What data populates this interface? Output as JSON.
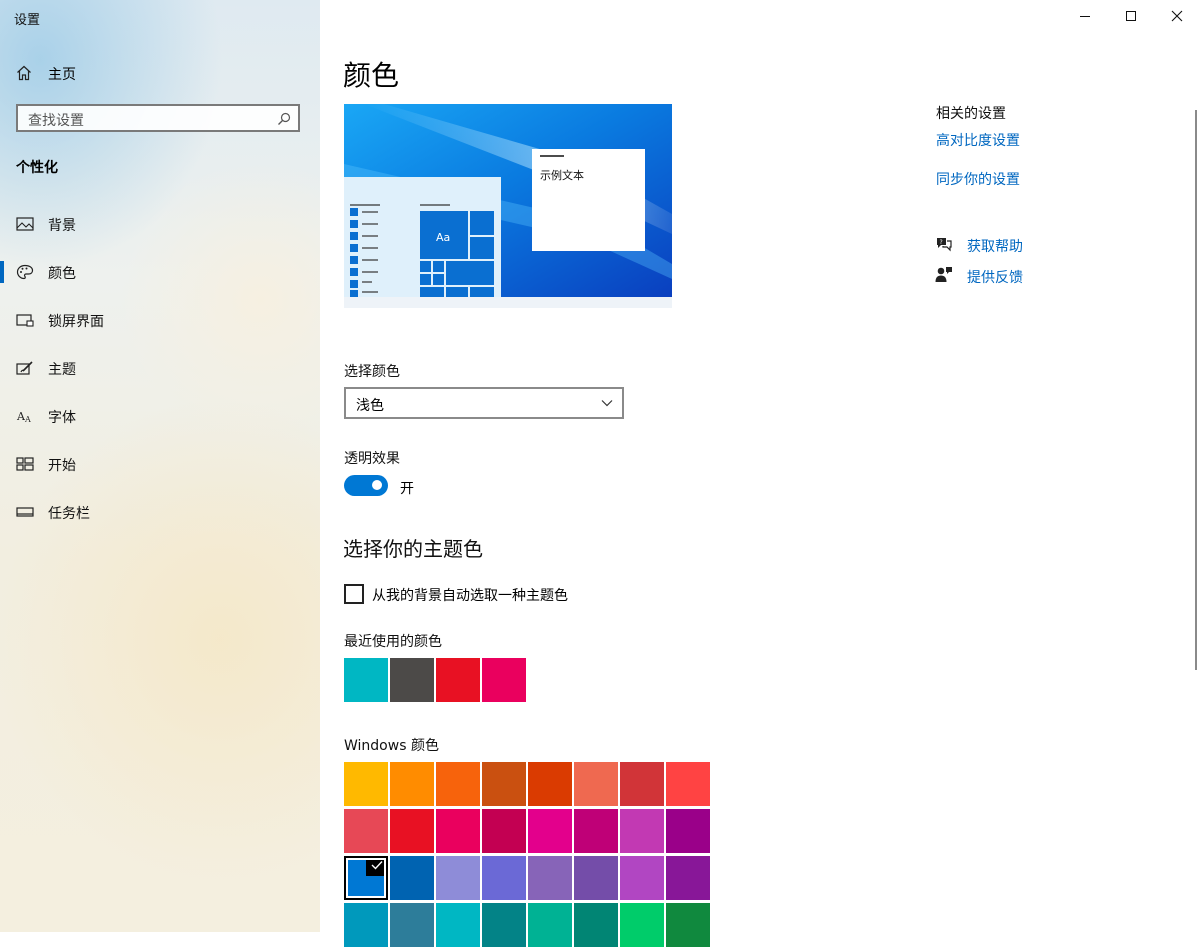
{
  "window": {
    "title": "设置",
    "minimize_icon": "minimize-icon",
    "maximize_icon": "maximize-icon",
    "close_icon": "close-icon"
  },
  "sidebar": {
    "home_label": "主页",
    "search_placeholder": "查找设置",
    "section_title": "个性化",
    "items": [
      {
        "label": "背景",
        "icon": "picture-icon",
        "selected": false
      },
      {
        "label": "颜色",
        "icon": "palette-icon",
        "selected": true
      },
      {
        "label": "锁屏界面",
        "icon": "lock-screen-icon",
        "selected": false
      },
      {
        "label": "主题",
        "icon": "theme-brush-icon",
        "selected": false
      },
      {
        "label": "字体",
        "icon": "font-icon",
        "selected": false
      },
      {
        "label": "开始",
        "icon": "start-menu-icon",
        "selected": false
      },
      {
        "label": "任务栏",
        "icon": "taskbar-icon",
        "selected": false
      }
    ]
  },
  "main": {
    "title": "颜色",
    "preview": {
      "sample_text": "示例文本",
      "tile_text": "Aa"
    },
    "choose_color": {
      "label": "选择颜色",
      "value": "浅色"
    },
    "transparency": {
      "label": "透明效果",
      "state_label": "开",
      "on": true
    },
    "accent_heading": "选择你的主题色",
    "auto_accent": {
      "label": "从我的背景自动选取一种主题色",
      "checked": false
    },
    "recent_colors": {
      "label": "最近使用的颜色",
      "colors": [
        "#00b7c3",
        "#4c4a48",
        "#e81123",
        "#ea005e"
      ]
    },
    "windows_colors": {
      "label": "Windows 颜色",
      "selected": "#0078d4",
      "colors": [
        "#ffb900",
        "#ff8c00",
        "#f7630c",
        "#ca5010",
        "#da3b01",
        "#ef6950",
        "#d13438",
        "#ff4343",
        "#e74856",
        "#e81123",
        "#ea005e",
        "#c30052",
        "#e3008c",
        "#bf0077",
        "#c239b3",
        "#9a0089",
        "#0078d4",
        "#0063b1",
        "#8e8cd8",
        "#6b69d6",
        "#8764b8",
        "#744da9",
        "#b146c2",
        "#881798",
        "#0099bc",
        "#2d7d9a",
        "#00b7c3",
        "#038387",
        "#00b294",
        "#018574",
        "#00cc6a",
        "#10893e"
      ]
    }
  },
  "related": {
    "title": "相关的设置",
    "links": [
      "高对比度设置",
      "同步你的设置"
    ],
    "help": [
      {
        "label": "获取帮助",
        "icon": "help-chat-icon"
      },
      {
        "label": "提供反馈",
        "icon": "feedback-icon"
      }
    ]
  },
  "colors": {
    "accent": "#0078d4",
    "link": "#0067c0"
  }
}
